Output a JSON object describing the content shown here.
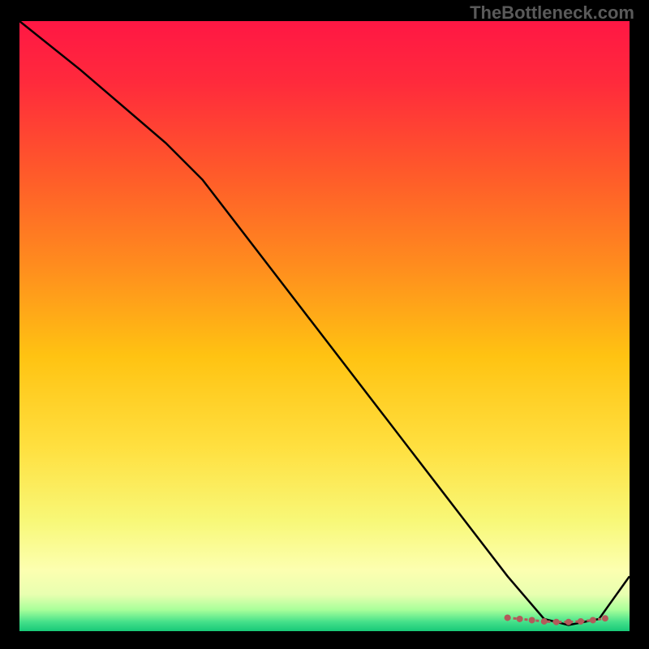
{
  "watermark": "TheBottleneck.com",
  "chart_data": {
    "type": "line",
    "title": "",
    "xlabel": "",
    "ylabel": "",
    "xlim": [
      0,
      100
    ],
    "ylim": [
      0,
      100
    ],
    "grid": false,
    "legend": false,
    "series": [
      {
        "name": "curve",
        "type": "line",
        "color": "#000000",
        "x": [
          0,
          10,
          24,
          30,
          40,
          50,
          60,
          70,
          80,
          86,
          90,
          95,
          100
        ],
        "values": [
          100,
          92,
          80,
          74,
          61,
          48,
          35,
          22,
          9,
          2,
          1,
          2,
          9
        ]
      },
      {
        "name": "markers",
        "type": "scatter",
        "color": "#b35a5a",
        "x": [
          80,
          82,
          84,
          86,
          88,
          90,
          92,
          94,
          96
        ],
        "values": [
          2.2,
          2.0,
          1.8,
          1.6,
          1.5,
          1.5,
          1.6,
          1.8,
          2.1
        ]
      }
    ],
    "gradient_stops": [
      {
        "offset": 0.0,
        "color": "#ff1744"
      },
      {
        "offset": 0.1,
        "color": "#ff2a3c"
      },
      {
        "offset": 0.25,
        "color": "#ff5a2a"
      },
      {
        "offset": 0.4,
        "color": "#ff8c1e"
      },
      {
        "offset": 0.55,
        "color": "#ffc312"
      },
      {
        "offset": 0.7,
        "color": "#ffe040"
      },
      {
        "offset": 0.82,
        "color": "#f8f878"
      },
      {
        "offset": 0.9,
        "color": "#fcffb0"
      },
      {
        "offset": 0.94,
        "color": "#e8ffb0"
      },
      {
        "offset": 0.965,
        "color": "#a8ff9a"
      },
      {
        "offset": 0.985,
        "color": "#44e08a"
      },
      {
        "offset": 1.0,
        "color": "#18c978"
      }
    ]
  }
}
